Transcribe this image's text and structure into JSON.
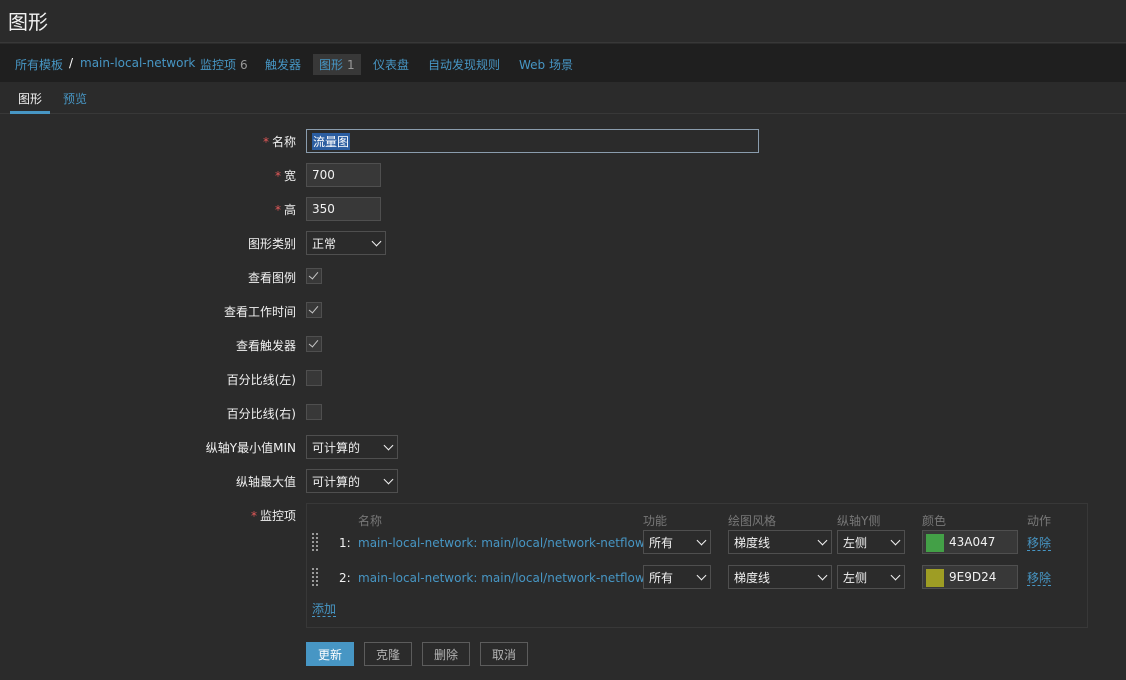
{
  "page": {
    "title": "图形"
  },
  "breadcrumb": {
    "all_templates": "所有模板",
    "separator": "/",
    "template": "main-local-network",
    "items_label": "监控项",
    "items_count": "6",
    "triggers_label": "触发器",
    "graphs_label": "图形",
    "graphs_count": "1",
    "dashboards_label": "仪表盘",
    "discovery_label": "自动发现规则",
    "web_label": "Web 场景"
  },
  "tabs": {
    "graph": "图形",
    "preview": "预览"
  },
  "form": {
    "required_mark": "*",
    "name_label": "名称",
    "name_value": "流量图",
    "width_label": "宽",
    "width_value": "700",
    "height_label": "高",
    "height_value": "350",
    "graph_type_label": "图形类别",
    "graph_type_value": "正常",
    "show_legend_label": "查看图例",
    "show_legend": true,
    "show_working_time_label": "查看工作时间",
    "show_working_time": true,
    "show_triggers_label": "查看触发器",
    "show_triggers": true,
    "percentile_left_label": "百分比线(左)",
    "percentile_left": false,
    "percentile_right_label": "百分比线(右)",
    "percentile_right": false,
    "ymin_label": "纵轴Y最小值MIN",
    "ymin_value": "可计算的",
    "ymax_label": "纵轴最大值",
    "ymax_value": "可计算的",
    "items_label": "监控项"
  },
  "items_table": {
    "headers": {
      "name": "名称",
      "function": "功能",
      "draw_style": "绘图风格",
      "y_axis": "纵轴Y侧",
      "color": "颜色",
      "action": "动作"
    },
    "rows": [
      {
        "num": "1:",
        "name": "main-local-network: main/local/network-netflow-out",
        "function": "所有",
        "draw_style": "梯度线",
        "y_axis": "左侧",
        "color": "#43A047",
        "color_hex": "43A047",
        "action": "移除"
      },
      {
        "num": "2:",
        "name": "main-local-network: main/local/network-netflow-in",
        "function": "所有",
        "draw_style": "梯度线",
        "y_axis": "左侧",
        "color": "#9E9D24",
        "color_hex": "9E9D24",
        "action": "移除"
      }
    ],
    "add_label": "添加"
  },
  "buttons": {
    "update": "更新",
    "clone": "克隆",
    "delete": "删除",
    "cancel": "取消"
  }
}
